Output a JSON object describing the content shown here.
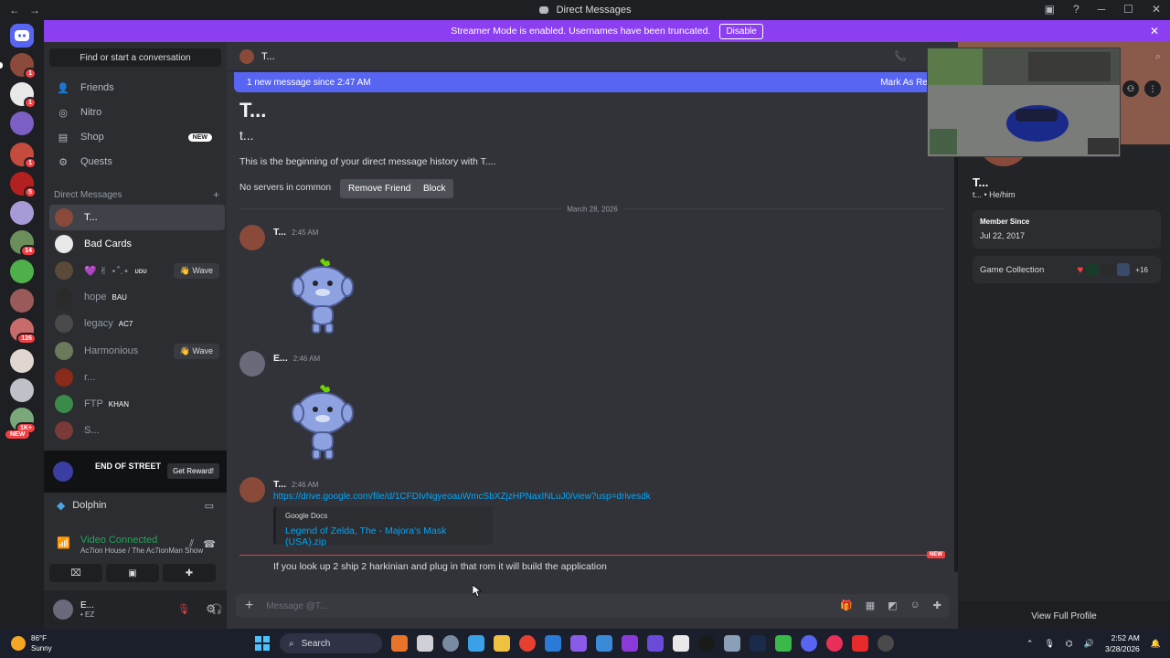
{
  "window": {
    "title": "Direct Messages"
  },
  "banner": {
    "text": "Streamer Mode is enabled. Usernames have been truncated.",
    "disable_label": "Disable"
  },
  "rail": {
    "badges": [
      "1",
      "1",
      "1",
      "5",
      "14",
      "126",
      "1K+"
    ],
    "new_label": "NEW"
  },
  "sidebar": {
    "find_label": "Find or start a conversation",
    "nav": [
      {
        "label": "Friends",
        "icon": "friends-icon"
      },
      {
        "label": "Nitro",
        "icon": "nitro-icon"
      },
      {
        "label": "Shop",
        "icon": "shop-icon",
        "badge": "NEW"
      },
      {
        "label": "Quests",
        "icon": "quests-icon"
      }
    ],
    "dm_header": "Direct Messages",
    "dms": [
      {
        "name": "T...",
        "tag": "",
        "wave": ""
      },
      {
        "name": "Bad Cards",
        "tag": "",
        "wave": ""
      },
      {
        "name": "💜 ✌ ⋆˚.⋆",
        "tag": "ᴜᴅᴜ",
        "wave": "👋 Wave"
      },
      {
        "name": "hope",
        "tag": "BAU",
        "wave": ""
      },
      {
        "name": "legacy",
        "tag": "AC7",
        "wave": ""
      },
      {
        "name": "Harmonious",
        "tag": "",
        "wave": "👋 Wave"
      },
      {
        "name": "r...",
        "tag": "",
        "wave": ""
      },
      {
        "name": "FTP",
        "tag": "KHAN",
        "wave": ""
      },
      {
        "name": "S...",
        "tag": "",
        "wave": ""
      }
    ],
    "ad": {
      "brand": "END OF STREET",
      "button": "Get Reward!"
    },
    "activity": {
      "name": "Dolphin"
    },
    "voice": {
      "status": "Video Connected",
      "channel": "Ac7ion House / The Ac7ionMan Show"
    },
    "user": {
      "name": "E...",
      "sub": "• EZ"
    }
  },
  "chat": {
    "header_name": "T...",
    "new_messages": "1 new message since 2:47 AM",
    "mark_read": "Mark As Read",
    "welcome_title": "T...",
    "welcome_sub": "t...",
    "welcome_desc": "This is the beginning of your direct message history with T....",
    "mutual": "No servers in common",
    "remove_friend": "Remove Friend",
    "block": "Block",
    "date": "March 28, 2026",
    "messages": [
      {
        "author": "T...",
        "time": "2:45 AM"
      },
      {
        "author": "E...",
        "time": "2:46 AM"
      },
      {
        "author": "T...",
        "time": "2:46 AM"
      }
    ],
    "link": "https://drive.google.com/file/d/1CFDIvNgyeoauWmcSbXZjzHPNaxINLuJ0/view?usp=drivesdk",
    "embed_provider": "Google Docs",
    "embed_title": "Legend of Zelda, The - Majora's Mask (USA).zip",
    "new_label": "NEW",
    "last_message": "If you look up 2 ship 2 harkinian and plug in that rom it will build the application",
    "placeholder": "Message @T..."
  },
  "profile": {
    "name": "T...",
    "pronouns": "t... • He/him",
    "member_since_label": "Member Since",
    "member_since": "Jul 22, 2017",
    "games_label": "Game Collection",
    "games_more": "+16",
    "view_full": "View Full Profile"
  },
  "taskbar": {
    "temp": "86°F",
    "weather": "Sunny",
    "search": "Search",
    "time": "2:52 AM",
    "date": "3/28/2026"
  },
  "colors": {
    "blurple": "#5865f2",
    "streamer_purple": "#8c3ff0",
    "online": "#23a55a",
    "danger": "#f23f43",
    "link": "#00a8fc"
  }
}
